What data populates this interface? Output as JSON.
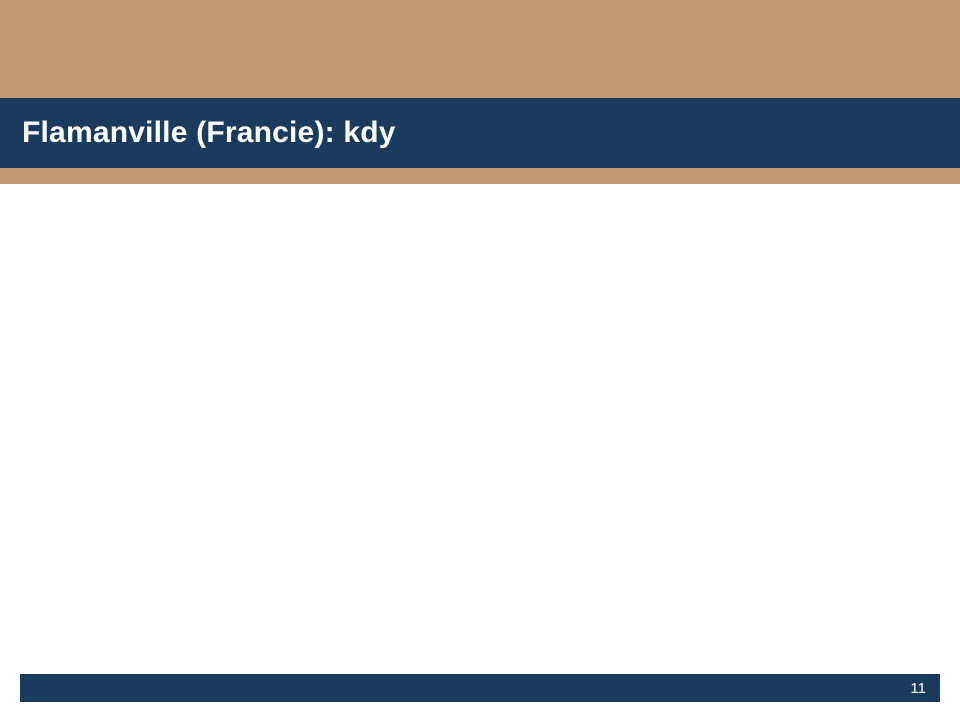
{
  "header": {
    "title": "Flamanville (Francie): kdy"
  },
  "footer": {
    "page_number": "11"
  },
  "colors": {
    "accent_tan": "#c49a75",
    "accent_navy": "#1b3b5e"
  }
}
